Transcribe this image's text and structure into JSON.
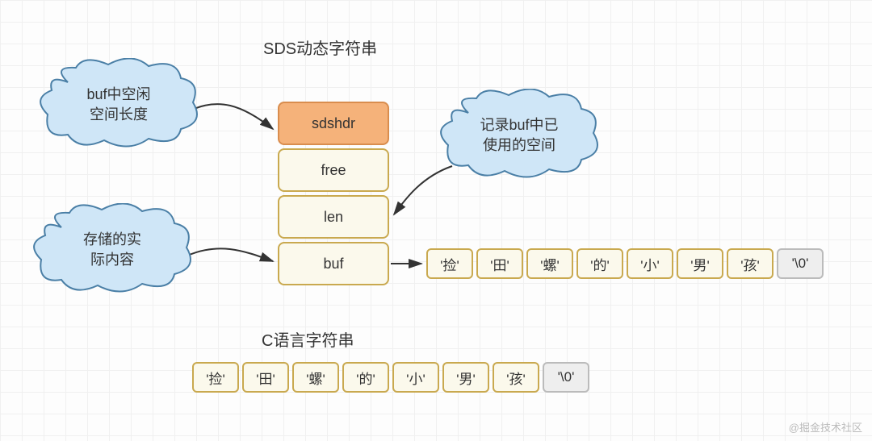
{
  "titles": {
    "sds": "SDS动态字符串",
    "c": "C语言字符串"
  },
  "clouds": {
    "free": "buf中空闲\n空间长度",
    "len": "记录buf中已\n使用的空间",
    "buf": "存储的实\n际内容"
  },
  "struct": {
    "header": "sdshdr",
    "free": "free",
    "len": "len",
    "buf": "buf"
  },
  "sds_chars": [
    "'捡'",
    "'田'",
    "'螺'",
    "'的'",
    "'小'",
    "'男'",
    "'孩'",
    "'\\0'"
  ],
  "c_chars": [
    "'捡'",
    "'田'",
    "'螺'",
    "'的'",
    "'小'",
    "'男'",
    "'孩'",
    "'\\0'"
  ],
  "watermark": "@掘金技术社区"
}
